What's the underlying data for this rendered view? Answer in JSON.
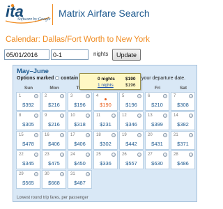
{
  "header": {
    "logo_text": "ita",
    "logo_subtitle": "Software by Google",
    "app_title": "Matrix Airfare Search"
  },
  "page_title": "Calendar: Dallas/Fort Worth to New York",
  "controls": {
    "date_value": "05/01/2016",
    "nights_value": "0-1",
    "nights_label": "nights",
    "update_label": "Update"
  },
  "calendar": {
    "month_title": "May–June",
    "note_bold": "Options marked",
    "note_mid": "contain ove",
    "note_end": "your departure date.",
    "weekdays": [
      "Sun",
      "Mon",
      "Tue",
      "",
      "",
      "Fri",
      "Sat"
    ],
    "days": [
      {
        "day": "1",
        "price": "$392",
        "icon": true
      },
      {
        "day": "2",
        "price": "$216",
        "icon": true
      },
      {
        "day": "3",
        "price": "$196",
        "icon": true
      },
      {
        "day": "4",
        "price": "$190",
        "icon": false,
        "selected": true
      },
      {
        "day": "5",
        "price": "$196",
        "icon": true
      },
      {
        "day": "6",
        "price": "$210",
        "icon": true
      },
      {
        "day": "7",
        "price": "$308",
        "icon": true
      },
      {
        "day": "8",
        "price": "$305",
        "icon": true
      },
      {
        "day": "9",
        "price": "$216",
        "icon": true
      },
      {
        "day": "10",
        "price": "$318",
        "icon": true
      },
      {
        "day": "11",
        "price": "$231",
        "icon": true
      },
      {
        "day": "12",
        "price": "$346",
        "icon": true
      },
      {
        "day": "13",
        "price": "$399",
        "icon": true
      },
      {
        "day": "14",
        "price": "$382",
        "icon": true
      },
      {
        "day": "15",
        "price": "$478",
        "icon": true
      },
      {
        "day": "16",
        "price": "$406",
        "icon": true
      },
      {
        "day": "17",
        "price": "$406",
        "icon": true
      },
      {
        "day": "18",
        "price": "$302",
        "icon": true
      },
      {
        "day": "19",
        "price": "$442",
        "icon": true
      },
      {
        "day": "20",
        "price": "$431",
        "icon": true
      },
      {
        "day": "21",
        "price": "$371",
        "icon": true
      },
      {
        "day": "22",
        "price": "$345",
        "icon": true
      },
      {
        "day": "23",
        "price": "$475",
        "icon": true
      },
      {
        "day": "24",
        "price": "$450",
        "icon": true
      },
      {
        "day": "25",
        "price": "$336",
        "icon": true
      },
      {
        "day": "26",
        "price": "$557",
        "icon": true
      },
      {
        "day": "27",
        "price": "$630",
        "icon": true
      },
      {
        "day": "28",
        "price": "$486",
        "icon": true
      },
      {
        "day": "29",
        "price": "$565",
        "icon": true
      },
      {
        "day": "30",
        "price": "$668",
        "icon": true
      },
      {
        "day": "31",
        "price": "$487",
        "icon": true
      }
    ],
    "footnote": "Lowest round trip fares, per passenger"
  },
  "tooltip": {
    "nights": "0 nights",
    "nights_price": "$190",
    "link": "1 nights",
    "link_price": "$196"
  },
  "colors": {
    "accent_orange": "#f08c22",
    "brand_blue": "#1f5a8f",
    "calendar_bg": "#d9e8f6",
    "tooltip_bg": "#fff8c4"
  }
}
